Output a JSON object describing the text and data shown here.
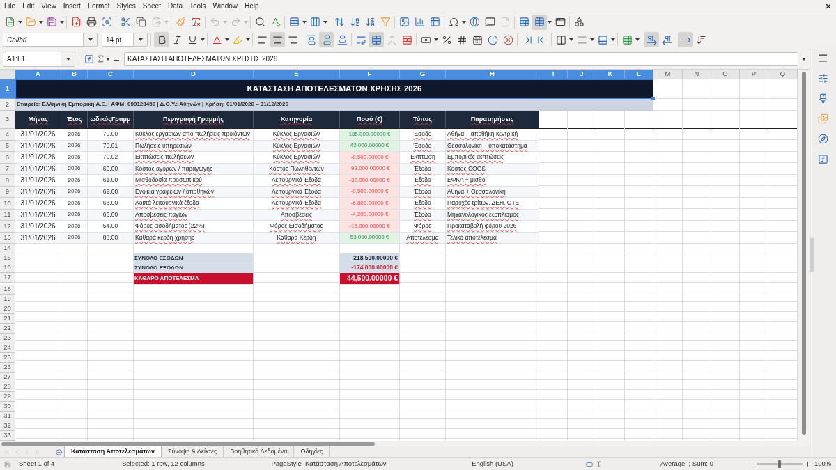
{
  "menu_bar": [
    "File",
    "Edit",
    "View",
    "Insert",
    "Format",
    "Styles",
    "Sheet",
    "Data",
    "Tools",
    "Window",
    "Help"
  ],
  "standard_toolbar": {
    "paste": {
      "disabled": true
    },
    "undo": {
      "disabled": true
    },
    "redo": {
      "disabled": true
    },
    "page": {
      "disabled": true
    },
    "freeze_panes": {
      "on": true
    }
  },
  "formatting_toolbar": {
    "font_name": "Calibri",
    "font_size": "14 pt",
    "bold": {
      "on": true
    },
    "italic": {
      "on": false
    },
    "underline": {
      "on": false
    },
    "align_left": {
      "on": false
    },
    "align_center": {
      "on": true
    },
    "align_right": {
      "on": false
    },
    "align_top": {
      "on": false
    },
    "align_middle": {
      "on": true
    },
    "align_bottom": {
      "on": false
    },
    "wrap_text": {
      "on": false
    },
    "merge_and_center": {
      "on": true
    },
    "merge_cells": {
      "disabled": true
    },
    "left_to_right": {
      "on": true
    },
    "right_to_left": {
      "on": false
    },
    "horizontal_text": {
      "on": true
    },
    "vertical_text": {
      "on": false
    }
  },
  "formula_bar": {
    "name_box": "A1:L1",
    "content": "ΚΑΤΑΣΤΑΣΗ ΑΠΟΤΕΛΕΣΜΑΤΩΝ ΧΡΗΣΗΣ 2026"
  },
  "sheet": {
    "column_headers": [
      {
        "label": "A",
        "selected": true
      },
      {
        "label": "B",
        "selected": true
      },
      {
        "label": "C",
        "selected": true
      },
      {
        "label": "D",
        "selected": true
      },
      {
        "label": "E",
        "selected": true
      },
      {
        "label": "F",
        "selected": true
      },
      {
        "label": "G",
        "selected": true
      },
      {
        "label": "H",
        "selected": true
      },
      {
        "label": "I",
        "selected": true
      },
      {
        "label": "J",
        "selected": true
      },
      {
        "label": "K",
        "selected": true
      },
      {
        "label": "L",
        "selected": true
      },
      {
        "label": "M",
        "selected": false
      },
      {
        "label": "N",
        "selected": false
      },
      {
        "label": "O",
        "selected": false
      },
      {
        "label": "P",
        "selected": false
      },
      {
        "label": "Q",
        "selected": false
      }
    ],
    "row_headers": [
      {
        "label": "1",
        "selected": true
      },
      {
        "label": "2",
        "selected": false
      },
      {
        "label": "3",
        "selected": false
      },
      {
        "label": "4",
        "selected": false
      },
      {
        "label": "5",
        "selected": false
      },
      {
        "label": "6",
        "selected": false
      },
      {
        "label": "7",
        "selected": false
      },
      {
        "label": "8",
        "selected": false
      },
      {
        "label": "9",
        "selected": false
      },
      {
        "label": "10",
        "selected": false
      },
      {
        "label": "11",
        "selected": false
      },
      {
        "label": "12",
        "selected": false
      },
      {
        "label": "13",
        "selected": false
      },
      {
        "label": "14",
        "selected": false
      },
      {
        "label": "15",
        "selected": false
      },
      {
        "label": "16",
        "selected": false
      },
      {
        "label": "17",
        "selected": false
      },
      {
        "label": "18",
        "selected": false
      },
      {
        "label": "19",
        "selected": false
      },
      {
        "label": "20",
        "selected": false
      },
      {
        "label": "21",
        "selected": false
      },
      {
        "label": "22",
        "selected": false
      },
      {
        "label": "23",
        "selected": false
      },
      {
        "label": "24",
        "selected": false
      },
      {
        "label": "25",
        "selected": false
      },
      {
        "label": "26",
        "selected": false
      },
      {
        "label": "27",
        "selected": false
      },
      {
        "label": "28",
        "selected": false
      },
      {
        "label": "29",
        "selected": false
      },
      {
        "label": "30",
        "selected": false
      },
      {
        "label": "31",
        "selected": false
      },
      {
        "label": "32",
        "selected": false
      },
      {
        "label": "33",
        "selected": false
      }
    ],
    "title": {
      "text": "ΚΑΤΑΣΤΑΣΗ ΑΠΟΤΕΛΕΣΜΑΤΩΝ ΧΡΗΣΗΣ 2026",
      "selected": true
    },
    "info": "Εταιρεία: Ελληνική Εμπορική Α.Ε. | ΑΦΜ: 099123456 | Δ.Ο.Υ.: Αθηνών | Χρήση: 01/01/2026 – 31/12/2026",
    "table": {
      "columns": [
        "Μήνας",
        "Έτος",
        "ωδικόςΓραμμ",
        "Περιγραφή Γραμμής",
        "Κατηγορία",
        "Ποσό (€)",
        "Τύπος",
        "Παρατηρήσεις"
      ],
      "rows": [
        {
          "month": "31/01/2026",
          "year": "2026",
          "code": "70.00",
          "description": "Κύκλος εργασιών από πωλήσεις προϊόντων",
          "category": "Κύκλος Εργασιών",
          "amount": "185,000.00000 €",
          "kind": "positive",
          "type": "Έσοδο",
          "notes": "Αθήνα – αποθήκη κεντρική"
        },
        {
          "month": "31/01/2026",
          "year": "2026",
          "code": "70.01",
          "description": "Πωλήσεις υπηρεσιών",
          "category": "Κύκλος Εργασιών",
          "amount": "42,000.00000 €",
          "kind": "positive",
          "type": "Έσοδο",
          "notes": "Θεσσαλονίκη – υποκατάστημα"
        },
        {
          "month": "31/01/2026",
          "year": "2026",
          "code": "70.02",
          "description": "Εκπτώσεις πωλήσεων",
          "category": "Κύκλος Εργασιών",
          "amount": "-8,500.00000 €",
          "kind": "negative",
          "type": "Έκπτωση",
          "notes": "Εμπορικές εκπτώσεις"
        },
        {
          "month": "31/01/2026",
          "year": "2026",
          "code": "60.00",
          "description": "Κόστος αγορών / παραγωγής",
          "category": "Κόστος Πωληθέντων",
          "amount": "-98,000.00000 €",
          "kind": "negative",
          "type": "Έξοδο",
          "notes": "Κόστος COGS"
        },
        {
          "month": "31/01/2026",
          "year": "2026",
          "code": "61.00",
          "description": "Μισθοδοσία προσωπικού",
          "category": "Λειτουργικά Έξοδα",
          "amount": "-32,000.00000 €",
          "kind": "negative",
          "type": "Έξοδο",
          "notes": "ΕΦΚΑ + μισθοί"
        },
        {
          "month": "31/01/2026",
          "year": "2026",
          "code": "62.00",
          "description": "Ενοίκια γραφείων / αποθηκών",
          "category": "Λειτουργικά Έξοδα",
          "amount": "-9,500.00000 €",
          "kind": "negative",
          "type": "Έξοδο",
          "notes": "Αθήνα + Θεσσαλονίκη"
        },
        {
          "month": "31/01/2026",
          "year": "2026",
          "code": "63.00",
          "description": "Λοιπά λειτουργικά έξοδα",
          "category": "Λειτουργικά Έξοδα",
          "amount": "-6,800.00000 €",
          "kind": "negative",
          "type": "Έξοδο",
          "notes": "Παροχές τρίτων, ΔΕΗ, ΟΤΕ"
        },
        {
          "month": "31/01/2026",
          "year": "2026",
          "code": "66.00",
          "description": "Αποσβέσεις παγίων",
          "category": "Αποσβέσεις",
          "amount": "-4,200.00000 €",
          "kind": "negative",
          "type": "Έξοδο",
          "notes": "Μηχανολογικός εξοπλισμός"
        },
        {
          "month": "31/01/2026",
          "year": "2026",
          "code": "54.00",
          "description": "Φόρος εισοδήματος (22%)",
          "category": "Φόρος Εισοδήματος",
          "amount": "-15,000.00000 €",
          "kind": "negative",
          "type": "Φόρος",
          "notes": "Προκαταβολή φόρου 2026"
        },
        {
          "month": "31/01/2026",
          "year": "2026",
          "code": "88.00",
          "description": "Καθαρά κέρδη χρήσης",
          "category": "Καθαρά Κέρδη",
          "amount": "53,000.00000 €",
          "kind": "positive",
          "type": "Αποτέλεσμα",
          "notes": "Τελικό αποτέλεσμα"
        }
      ]
    },
    "totals": [
      {
        "label": "ΣΥΝΟΛΟ ΕΣΟΔΩΝ",
        "value": "218,500.00000 €",
        "kind": "income"
      },
      {
        "label": "ΣΥΝΟΛΟ ΕΞΟΔΩΝ",
        "value": "-174,000.00000 €",
        "kind": "expense"
      },
      {
        "label": "ΚΑΘΑΡΟ ΑΠΟΤΕΛΕΣΜΑ",
        "value": "44,500.00000 €",
        "kind": "net"
      }
    ]
  },
  "sheet_tabs": [
    {
      "label": "Κατάσταση Αποτελεσμάτων",
      "selected": true
    },
    {
      "label": "Σύνοψη & Δείκτες",
      "selected": false
    },
    {
      "label": "Βοηθητικά Δεδομένα",
      "selected": false
    },
    {
      "label": "Οδηγίες",
      "selected": false
    }
  ],
  "status_bar": {
    "sheet": "Sheet 1 of 4",
    "selection": "Selected: 1 row, 12 columns",
    "page_style": "PageStyle_Κατάσταση Αποτελεσμάτων",
    "language": "English (USA)",
    "summary": "Average: ; Sum: 0",
    "zoom": {
      "level": 0.5,
      "label": "100%"
    }
  }
}
